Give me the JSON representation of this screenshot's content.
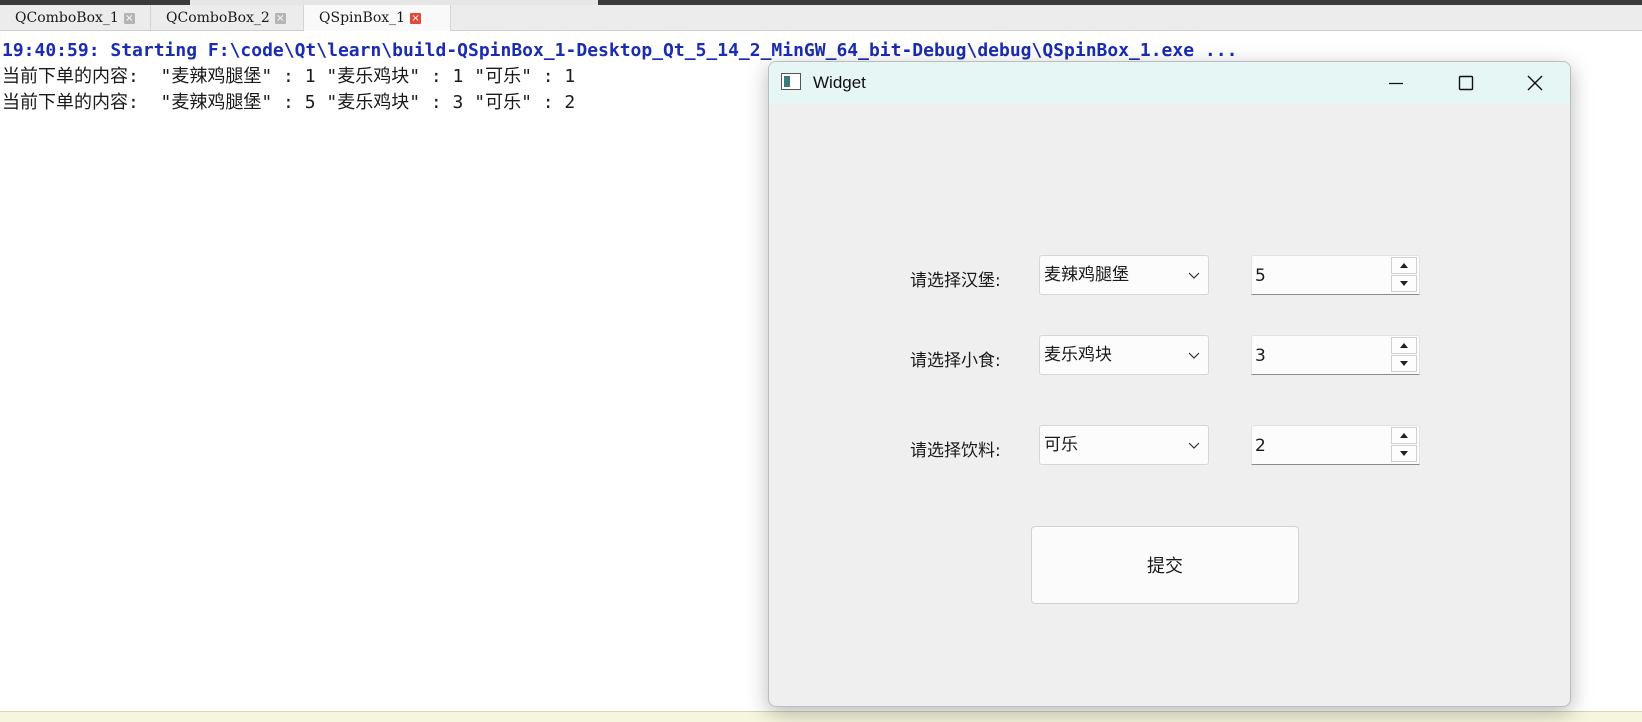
{
  "tabs": [
    {
      "label": "QComboBox_1",
      "active": false
    },
    {
      "label": "QComboBox_2",
      "active": false
    },
    {
      "label": "QSpinBox_1",
      "active": true
    }
  ],
  "output": {
    "start_line": "19:40:59: Starting F:\\code\\Qt\\learn\\build-QSpinBox_1-Desktop_Qt_5_14_2_MinGW_64_bit-Debug\\debug\\QSpinBox_1.exe ...",
    "lines": [
      "当前下单的内容:  \"麦辣鸡腿堡\" : 1 \"麦乐鸡块\" : 1 \"可乐\" : 1",
      "当前下单的内容:  \"麦辣鸡腿堡\" : 5 \"麦乐鸡块\" : 3 \"可乐\" : 2"
    ]
  },
  "window": {
    "title": "Widget",
    "icons": {
      "minimize": "minimize-icon",
      "maximize": "maximize-icon",
      "close": "close-icon"
    },
    "rows": [
      {
        "label": "请选择汉堡:",
        "combo_value": "麦辣鸡腿堡",
        "spin_value": "5"
      },
      {
        "label": "请选择小食:",
        "combo_value": "麦乐鸡块",
        "spin_value": "3"
      },
      {
        "label": "请选择饮料:",
        "combo_value": "可乐",
        "spin_value": "2"
      }
    ],
    "submit_label": "提交"
  },
  "colors": {
    "output_start": "#1a2cb0",
    "titlebar": "#e6f6f4",
    "active_tab_close": "#e04a3a",
    "bottom_strip": "#f6f6de"
  }
}
